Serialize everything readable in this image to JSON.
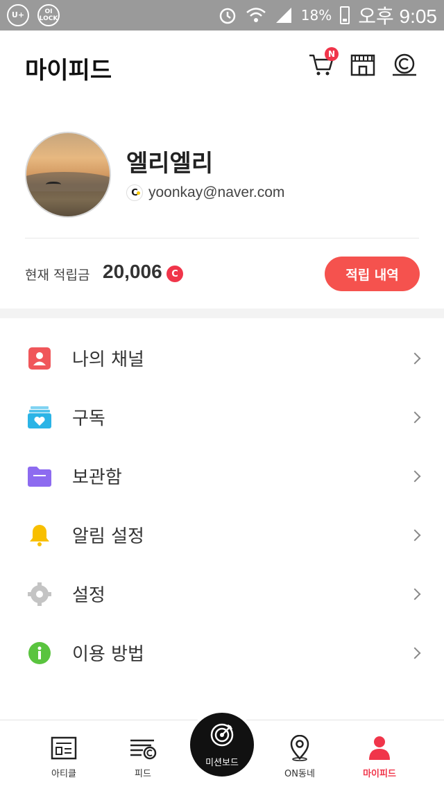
{
  "status_bar": {
    "left_badges": [
      "U+",
      "OI\nLOCK"
    ],
    "battery": "18%",
    "time": "오후 9:05"
  },
  "header": {
    "title": "마이피드",
    "cart_badge": "N",
    "icons": [
      "cart-icon",
      "store-icon",
      "coin-icon"
    ]
  },
  "profile": {
    "name": "엘리엘리",
    "email": "yoonkay@naver.com",
    "login_provider_glyph": "C"
  },
  "points": {
    "label": "현재 적립금",
    "value": "20,006",
    "currency_glyph": "C",
    "history_button": "적립 내역"
  },
  "menu": [
    {
      "label": "나의 채널",
      "icon": "user-card-icon",
      "color": "#f0565a"
    },
    {
      "label": "구독",
      "icon": "subscribe-heart-icon",
      "color": "#2bb4e6"
    },
    {
      "label": "보관함",
      "icon": "folder-icon",
      "color": "#8d6bf0"
    },
    {
      "label": "알림 설정",
      "icon": "bell-icon",
      "color": "#f8bf00"
    },
    {
      "label": "설정",
      "icon": "gear-icon",
      "color": "#c4c4c4"
    },
    {
      "label": "이용 방법",
      "icon": "info-icon",
      "color": "#5ac43f"
    }
  ],
  "bottom_nav": [
    {
      "label": "아티클",
      "icon": "article-icon"
    },
    {
      "label": "피드",
      "icon": "feed-icon"
    },
    {
      "label": "미션보드",
      "icon": "target-icon"
    },
    {
      "label": "ON동네",
      "icon": "location-pin-icon"
    },
    {
      "label": "마이피드",
      "icon": "person-icon",
      "active": true
    }
  ],
  "colors": {
    "accent": "#f0354a",
    "button": "#f5524e"
  }
}
